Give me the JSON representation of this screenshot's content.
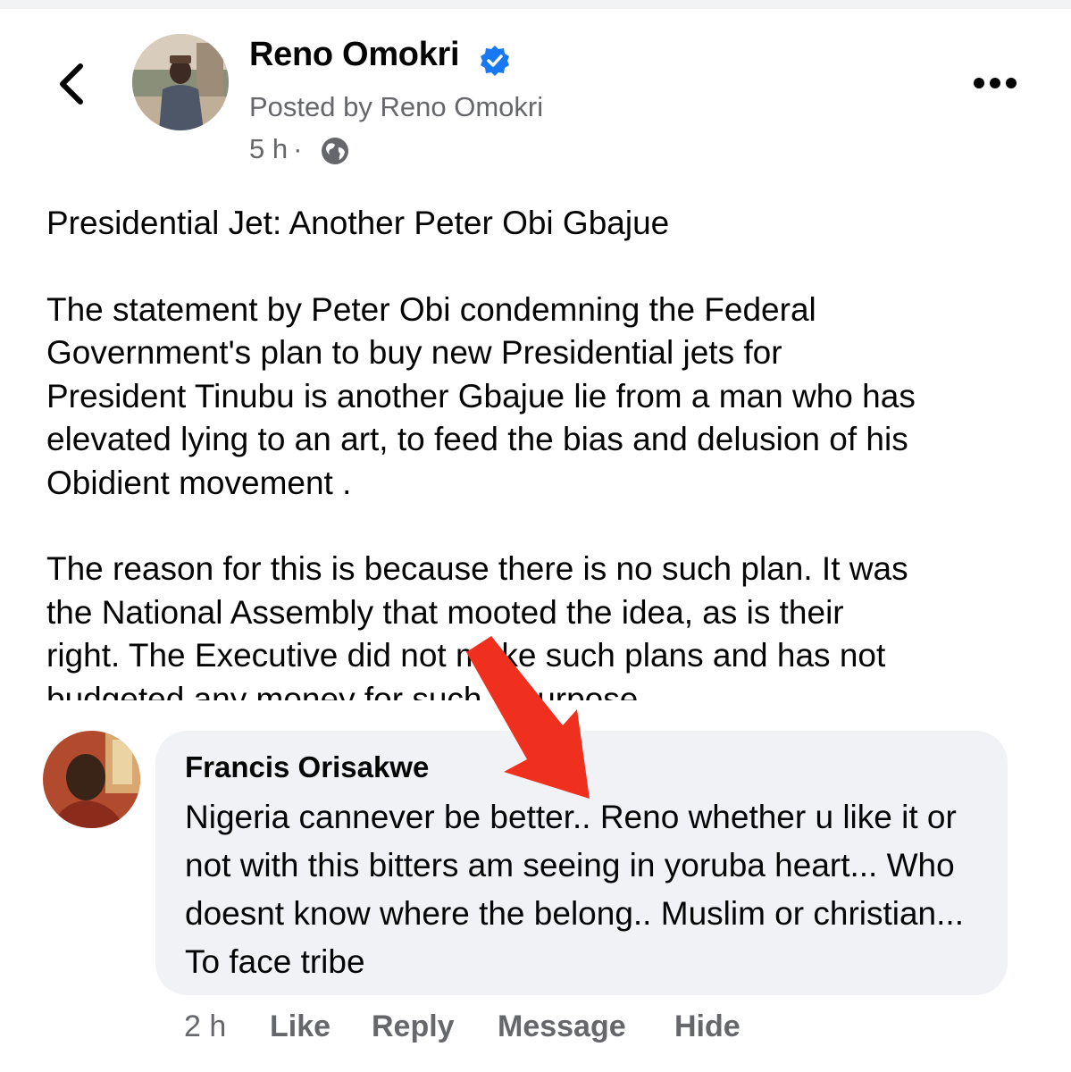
{
  "post": {
    "author_name": "Reno Omokri",
    "posted_by": "Posted by Reno Omokri",
    "time": "5 h",
    "separator": "·",
    "title": "Presidential Jet: Another Peter Obi Gbajue",
    "paragraphs": [
      "The statement by Peter Obi condemning the Federal\nGovernment's plan to buy new Presidential jets for\nPresident Tinubu is another Gbajue lie from a man who has\nelevated lying to an art, to feed the bias and delusion of his\nObidient movement .",
      "The reason for this is because there is no such plan. It was\nthe National Assembly that mooted the idea, as is their\nright. The Executive did not make such plans and has not\nbudgeted any money for such a purpose."
    ]
  },
  "comment": {
    "author_name": "Francis Orisakwe",
    "text": "Nigeria cannever be better.. Reno whether u like it or not with this bitters am seeing in yoruba heart... Who doesnt know where the belong.. Muslim or christian... To face tribe",
    "time": "2 h",
    "actions": {
      "like": "Like",
      "reply": "Reply",
      "message": "Message",
      "hide": "Hide"
    }
  },
  "icons": {
    "back": "chevron-left-icon",
    "verified": "verified-badge-icon",
    "privacy": "globe-icon",
    "more": "more-options-icon",
    "annotation": "red-arrow"
  },
  "colors": {
    "verified_blue": "#1877f2",
    "secondary_text": "#65676b",
    "bubble_bg": "#f0f2f5",
    "arrow_red": "#f0301e"
  }
}
